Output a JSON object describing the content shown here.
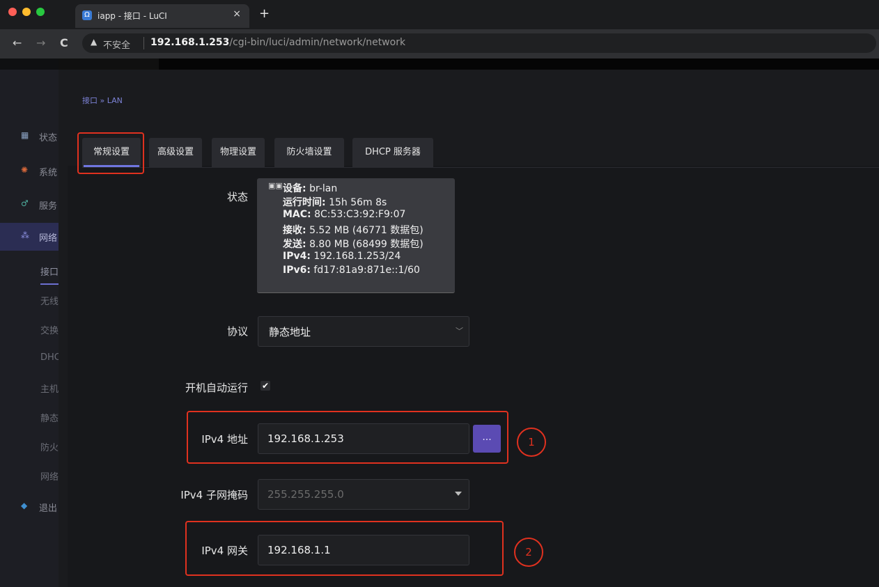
{
  "browser": {
    "tab_title": "iapp - 接口 - LuCI",
    "tab_close": "×",
    "new_tab": "+",
    "nav_back": "←",
    "nav_forward": "→",
    "nav_reload": "C",
    "security_label": "不安全",
    "url_host": "192.168.1.253",
    "url_path": "/cgi-bin/luci/admin/network/network",
    "favicon": "Ω"
  },
  "sidebar": {
    "items": [
      {
        "label": "状态",
        "icon": "grid-icon",
        "glyph": "▦"
      },
      {
        "label": "系统",
        "icon": "gear-icon",
        "glyph": "✺"
      },
      {
        "label": "服务",
        "icon": "services-icon",
        "glyph": "♂"
      },
      {
        "label": "网络",
        "icon": "network-icon",
        "glyph": "⁂"
      },
      {
        "label": "退出",
        "icon": "logout-icon",
        "glyph": "◆"
      }
    ],
    "sub_items": [
      "接口",
      "无线",
      "交换机",
      "DHCP/DNS",
      "主机名",
      "静态路由",
      "防火墙",
      "网络诊断"
    ]
  },
  "breadcrumb": "接口 » LAN",
  "tabs": [
    "常规设置",
    "高级设置",
    "物理设置",
    "防火墙设置",
    "DHCP 服务器"
  ],
  "form": {
    "status_label": "状态",
    "status": {
      "device_label": "设备:",
      "device": "br-lan",
      "uptime_label": "运行时间:",
      "uptime": "15h 56m 8s",
      "mac_label": "MAC:",
      "mac": "8C:53:C3:92:F9:07",
      "rx_label": "接收:",
      "rx": "5.52 MB (46771 数据包)",
      "tx_label": "发送:",
      "tx": "8.80 MB (68499 数据包)",
      "ipv4_label": "IPv4:",
      "ipv4": "192.168.1.253/24",
      "ipv6_label": "IPv6:",
      "ipv6": "fd17:81a9:871e::1/60"
    },
    "protocol_label": "协议",
    "protocol_value": "静态地址",
    "autostart_label": "开机自动运行",
    "autostart_checked": true,
    "ipv4_addr_label": "IPv4 地址",
    "ipv4_addr_value": "192.168.1.253",
    "more_button": "...",
    "netmask_label": "IPv4 子网掩码",
    "netmask_value": "255.255.255.0",
    "gateway_label": "IPv4 网关",
    "gateway_value": "192.168.1.1"
  },
  "annotations": [
    "1",
    "2"
  ],
  "colors": {
    "accent": "#7076e0",
    "annotation": "#e0311f",
    "button": "#5b4bb3"
  }
}
